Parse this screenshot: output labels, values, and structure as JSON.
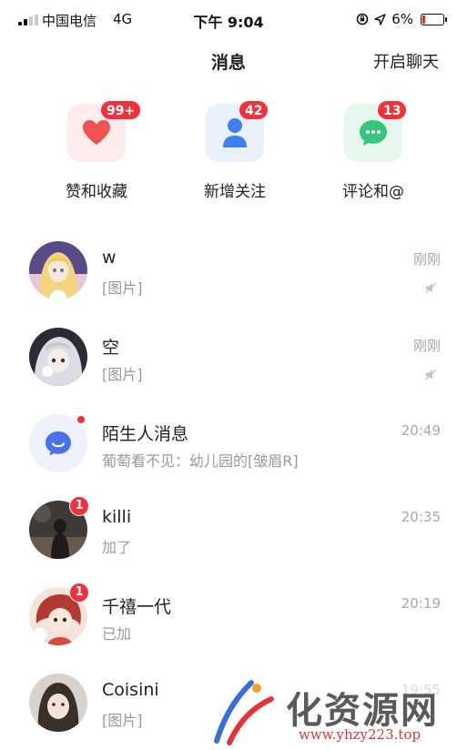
{
  "status_bar": {
    "carrier": "中国电信",
    "network": "4G",
    "time": "下午 9:04",
    "battery": "6%",
    "battery_level": 0.06,
    "signal_bars": 2
  },
  "header": {
    "title": "消息",
    "action": "开启聊天"
  },
  "categories": [
    {
      "label": "赞和收藏",
      "badge": "99+",
      "icon": "heart-icon",
      "tile_color": "#fdeceb",
      "icon_color": "#f0524f"
    },
    {
      "label": "新增关注",
      "badge": "42",
      "icon": "person-icon",
      "tile_color": "#e9f1fd",
      "icon_color": "#3d7ff5"
    },
    {
      "label": "评论和@",
      "badge": "13",
      "icon": "chat-bubble-icon",
      "tile_color": "#e6f7ee",
      "icon_color": "#36c57d"
    }
  ],
  "messages": [
    {
      "name": "w",
      "preview": "[图片]",
      "time": "刚刚",
      "muted": true,
      "badge": "",
      "dot": false
    },
    {
      "name": "空",
      "preview": "[图片]",
      "time": "刚刚",
      "muted": true,
      "badge": "",
      "dot": false
    },
    {
      "name": "陌生人消息",
      "preview": "葡萄看不见：幼儿园的[皱眉R]",
      "time": "20:49",
      "muted": false,
      "badge": "",
      "dot": true
    },
    {
      "name": "killi",
      "preview": "加了",
      "time": "20:35",
      "muted": false,
      "badge": "1",
      "dot": false
    },
    {
      "name": "千禧一代",
      "preview": "已加",
      "time": "20:19",
      "muted": false,
      "badge": "1",
      "dot": false
    },
    {
      "name": "Coisini",
      "preview": "[图片]",
      "time": "19:55",
      "muted": false,
      "badge": "",
      "dot": false
    }
  ],
  "watermark": {
    "text": "化资源网",
    "url": "www.yhzy223.top"
  },
  "colors": {
    "badge_red": "#f0323c",
    "stranger_icon": "#4a72f0"
  }
}
